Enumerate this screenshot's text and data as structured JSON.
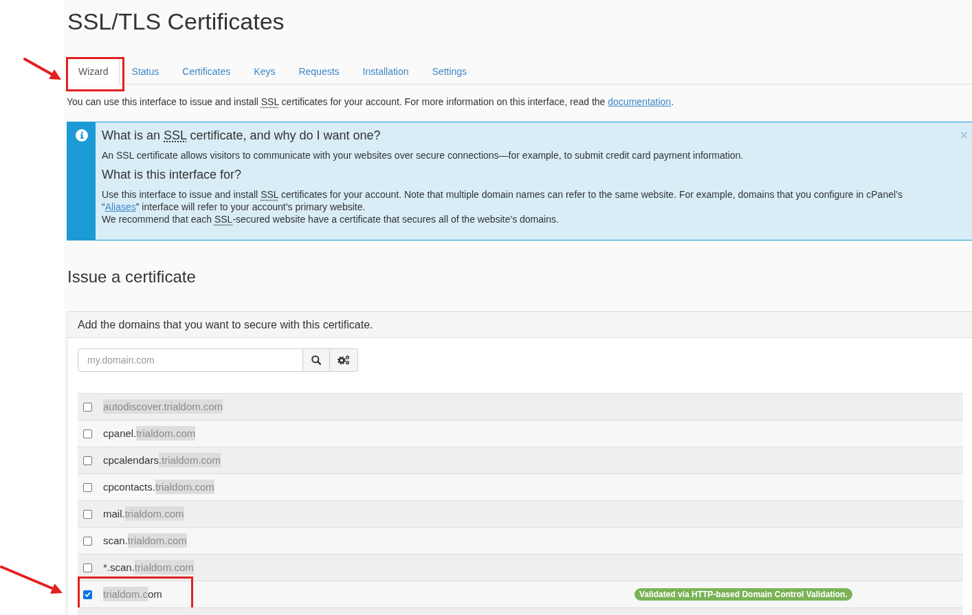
{
  "page": {
    "title": "SSL/TLS Certificates"
  },
  "tabs": [
    {
      "label": "Wizard",
      "selected": true,
      "annotated": true
    },
    {
      "label": "Status",
      "selected": false,
      "annotated": false
    },
    {
      "label": "Certificates",
      "selected": false,
      "annotated": false
    },
    {
      "label": "Keys",
      "selected": false,
      "annotated": false
    },
    {
      "label": "Requests",
      "selected": false,
      "annotated": false
    },
    {
      "label": "Installation",
      "selected": false,
      "annotated": false
    },
    {
      "label": "Settings",
      "selected": false,
      "annotated": false
    }
  ],
  "intro": [
    {
      "kind": "plain",
      "text": "You can use this interface to issue and install "
    },
    {
      "kind": "abbr",
      "text": "SSL"
    },
    {
      "kind": "plain",
      "text": " certificates for your account. For more information on this interface, read the "
    },
    {
      "kind": "link",
      "text": "documentation"
    },
    {
      "kind": "plain",
      "text": "."
    }
  ],
  "info_box": {
    "sections": [
      {
        "heading": [
          {
            "kind": "plain",
            "text": "What is an "
          },
          {
            "kind": "abbr",
            "text": "SSL"
          },
          {
            "kind": "plain",
            "text": " certificate, and why do I want one?"
          }
        ],
        "paragraphs": [
          [
            {
              "kind": "plain",
              "text": "An SSL certificate allows visitors to communicate with your websites over secure connections—for example, to submit credit card payment information."
            }
          ]
        ]
      },
      {
        "heading": [
          {
            "kind": "plain",
            "text": "What is this interface for?"
          }
        ],
        "paragraphs": [
          [
            {
              "kind": "plain",
              "text": "Use this interface to issue and install "
            },
            {
              "kind": "abbr",
              "text": "SSL"
            },
            {
              "kind": "plain",
              "text": " certificates for your account. Note that multiple domain names can refer to the same website. For example, domains that you configure in cPanel’s “"
            },
            {
              "kind": "link",
              "text": "Aliases"
            },
            {
              "kind": "plain",
              "text": "” interface will refer to your account’s primary website."
            }
          ],
          [
            {
              "kind": "plain",
              "text": "We recommend that each "
            },
            {
              "kind": "abbr",
              "text": "SSL"
            },
            {
              "kind": "plain",
              "text": "-secured website have a certificate that secures all of the website’s domains."
            }
          ]
        ]
      }
    ]
  },
  "issue_heading": "Issue a certificate",
  "panel": {
    "heading": "Add the domains that you want to secure with this certificate.",
    "search": {
      "placeholder": "my.domain.com"
    }
  },
  "domains": [
    {
      "checked": false,
      "annotated": false,
      "parts": [
        {
          "text": "autodiscover.trialdom.com",
          "blurred": true
        }
      ]
    },
    {
      "checked": false,
      "annotated": false,
      "parts": [
        {
          "text": "cpanel.",
          "blurred": false
        },
        {
          "text": "trialdom.com",
          "blurred": true
        }
      ]
    },
    {
      "checked": false,
      "annotated": false,
      "parts": [
        {
          "text": "cpcalendars",
          "blurred": false
        },
        {
          "text": ".trialdom.com",
          "blurred": true
        }
      ]
    },
    {
      "checked": false,
      "annotated": false,
      "parts": [
        {
          "text": "cpcontacts.",
          "blurred": false
        },
        {
          "text": "trialdom.com",
          "blurred": true
        }
      ]
    },
    {
      "checked": false,
      "annotated": false,
      "parts": [
        {
          "text": "mail.",
          "blurred": false
        },
        {
          "text": "trialdom.com",
          "blurred": true
        }
      ]
    },
    {
      "checked": false,
      "annotated": false,
      "parts": [
        {
          "text": "scan.",
          "blurred": false
        },
        {
          "text": "trialdom.com",
          "blurred": true
        }
      ]
    },
    {
      "checked": false,
      "annotated": false,
      "parts": [
        {
          "text": "*.scan.",
          "blurred": false
        },
        {
          "text": "trialdom.com",
          "blurred": true
        }
      ]
    },
    {
      "checked": true,
      "annotated": true,
      "parts": [
        {
          "text": "trialdom.c",
          "blurred": true
        },
        {
          "text": "om",
          "blurred": false
        }
      ],
      "status": "Validated via HTTP-based Domain Control Validation."
    }
  ]
}
